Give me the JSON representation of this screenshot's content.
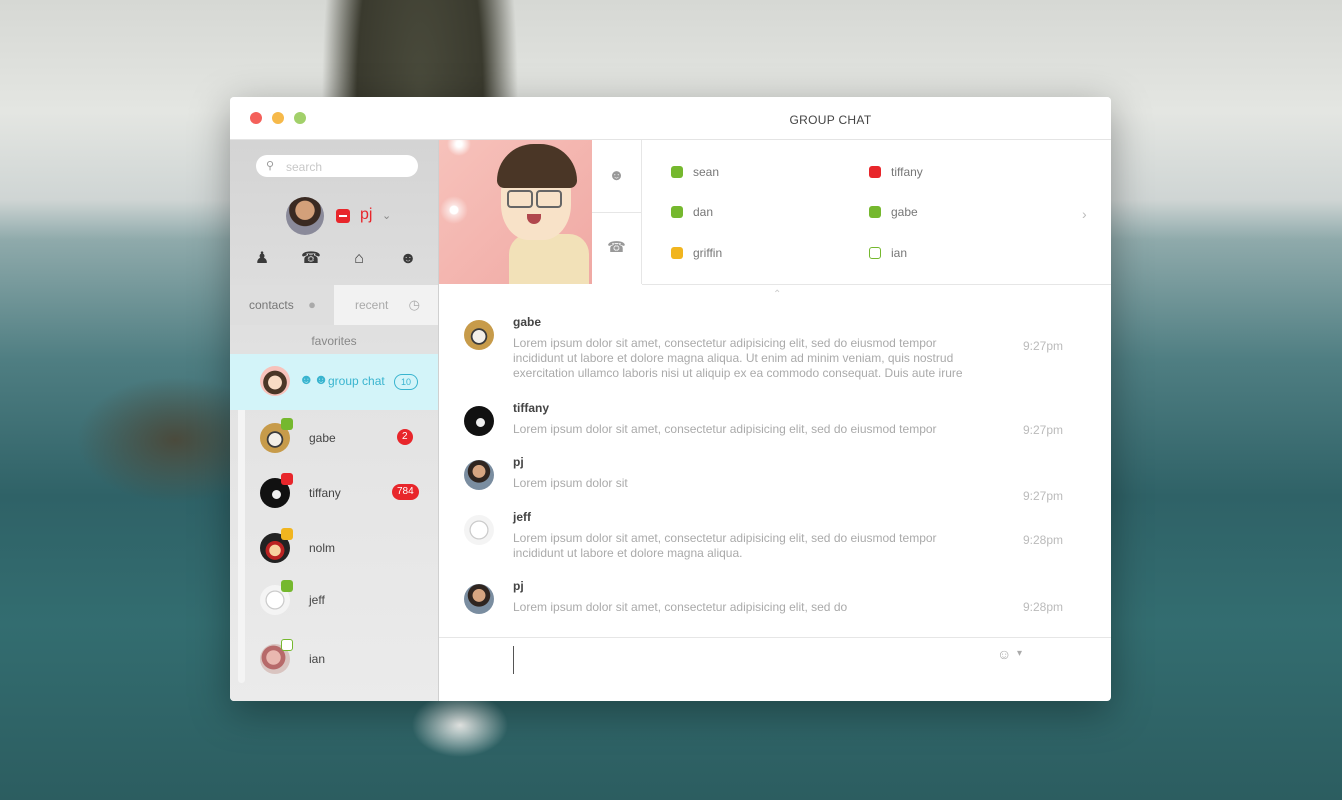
{
  "window": {
    "title": "GROUP CHAT"
  },
  "search": {
    "placeholder": "search"
  },
  "me": {
    "name": "pj",
    "status": "dnd"
  },
  "nav_icons": [
    "user-icon",
    "phone-icon",
    "home-icon",
    "group-icon"
  ],
  "tabs": [
    {
      "label": "contacts",
      "icon": "person-icon"
    },
    {
      "label": "recent",
      "icon": "clock-icon"
    }
  ],
  "sidebar": {
    "section_label": "favorites",
    "group_chat": {
      "label": "group chat",
      "count": "10"
    },
    "contacts": [
      {
        "name": "gabe",
        "status": "online",
        "badge": "2"
      },
      {
        "name": "tiffany",
        "status": "dnd",
        "badge": "784"
      },
      {
        "name": "nolm",
        "status": "away",
        "badge": ""
      },
      {
        "name": "jeff",
        "status": "online",
        "badge": ""
      },
      {
        "name": "ian",
        "status": "offline",
        "badge": ""
      }
    ]
  },
  "participants": [
    {
      "name": "sean",
      "status": "online"
    },
    {
      "name": "tiffany",
      "status": "dnd"
    },
    {
      "name": "dan",
      "status": "online"
    },
    {
      "name": "gabe",
      "status": "online"
    },
    {
      "name": "griffin",
      "status": "away"
    },
    {
      "name": "ian",
      "status": "offline"
    }
  ],
  "messages": [
    {
      "sender": "gabe",
      "text": "Lorem ipsum dolor sit amet, consectetur adipisicing elit, sed do eiusmod tempor incididunt ut labore et dolore magna aliqua. Ut enim ad minim veniam, quis nostrud exercitation ullamco laboris nisi ut aliquip ex ea commodo consequat. Duis aute irure",
      "time": "9:27pm"
    },
    {
      "sender": "tiffany",
      "text": "Lorem ipsum dolor sit amet, consectetur adipisicing elit, sed do eiusmod tempor",
      "time": "9:27pm"
    },
    {
      "sender": "pj",
      "text": "Lorem ipsum dolor sit",
      "time": "9:27pm"
    },
    {
      "sender": "jeff",
      "text": "Lorem ipsum dolor sit amet, consectetur adipisicing elit, sed do eiusmod tempor incididunt ut labore et dolore magna aliqua.",
      "time": "9:28pm"
    },
    {
      "sender": "pj",
      "text": "Lorem ipsum dolor sit amet, consectetur adipisicing elit, sed do",
      "time": "9:28pm"
    }
  ],
  "compose": {
    "value": ""
  },
  "colors": {
    "accent": "#39b4cf",
    "online": "#75b82e",
    "dnd": "#e8262b",
    "away": "#f1b51f"
  }
}
